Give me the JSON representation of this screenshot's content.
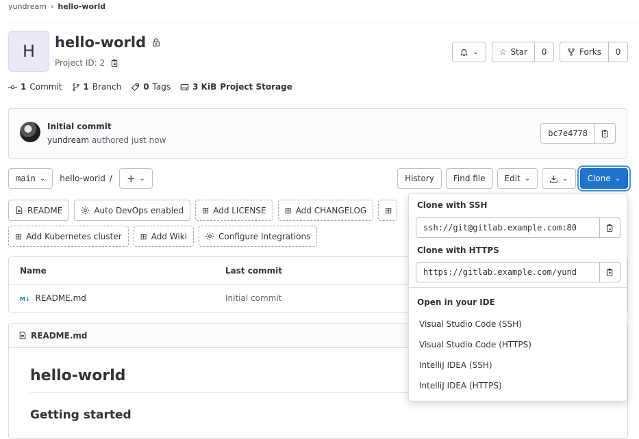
{
  "breadcrumb": {
    "namespace": "yundream",
    "project": "hello-world"
  },
  "project": {
    "avatar_letter": "H",
    "name": "hello-world",
    "id_label": "Project ID: 2"
  },
  "header_actions": {
    "star_label": "Star",
    "star_count": "0",
    "forks_label": "Forks",
    "forks_count": "0"
  },
  "stats": [
    {
      "count": "1",
      "label": "Commit",
      "icon": "commit-icon"
    },
    {
      "count": "1",
      "label": "Branch",
      "icon": "branch-icon"
    },
    {
      "count": "0",
      "label": "Tags",
      "icon": "tag-icon"
    },
    {
      "count": "3 KiB",
      "label": "Project Storage",
      "icon": "storage-icon"
    }
  ],
  "last_commit": {
    "message": "Initial commit",
    "author": "yundream",
    "authored_text": "authored just now",
    "sha": "bc7e4778"
  },
  "tree": {
    "branch": "main",
    "path": "hello-world",
    "path_sep": "/",
    "history": "History",
    "find_file": "Find file",
    "edit": "Edit",
    "clone": "Clone"
  },
  "shortcuts": {
    "readme": "README",
    "auto_devops": "Auto DevOps enabled",
    "add_license": "Add LICENSE",
    "add_changelog": "Add CHANGELOG",
    "add_k8s": "Add Kubernetes cluster",
    "add_wiki": "Add Wiki",
    "configure_integrations": "Configure Integrations"
  },
  "files": {
    "headers": {
      "name": "Name",
      "last_commit": "Last commit"
    },
    "rows": [
      {
        "name": "README.md",
        "badge": "M↓",
        "last_commit": "Initial commit"
      }
    ]
  },
  "readme": {
    "filename": "README.md",
    "h1": "hello-world",
    "h2": "Getting started"
  },
  "clone_dropdown": {
    "ssh_label": "Clone with SSH",
    "ssh_url": "ssh://git@gitlab.example.com:80",
    "https_label": "Clone with HTTPS",
    "https_url": "https://gitlab.example.com/yund",
    "ide_label": "Open in your IDE",
    "ide_options": [
      "Visual Studio Code (SSH)",
      "Visual Studio Code (HTTPS)",
      "IntelliJ IDEA (SSH)",
      "IntelliJ IDEA (HTTPS)"
    ]
  },
  "colors": {
    "primary": "#1f75cb",
    "border": "#dcdcde",
    "text": "#333238",
    "muted": "#626168"
  }
}
